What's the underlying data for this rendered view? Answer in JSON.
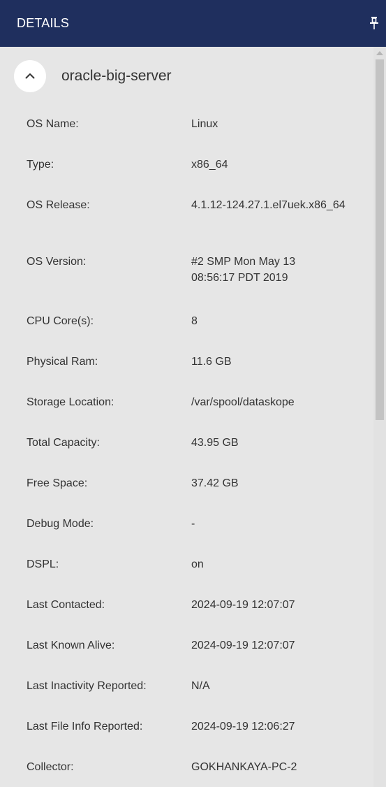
{
  "header": {
    "title": "DETAILS",
    "pin_icon": "pin-icon",
    "background": "#1f2f5e"
  },
  "server": {
    "name": "oracle-big-server",
    "toggle_icon": "chevron-up-icon"
  },
  "details": [
    {
      "label": "OS Name:",
      "value": "Linux"
    },
    {
      "label": "Type:",
      "value": "x86_64"
    },
    {
      "label": "OS Release:",
      "value": "4.1.12-124.27.1.el7uek.x86_64"
    },
    {
      "label": "OS Version:",
      "value": "#2 SMP Mon May 13 08:56:17 PDT 2019"
    },
    {
      "label": "CPU Core(s):",
      "value": "8"
    },
    {
      "label": "Physical Ram:",
      "value": "11.6 GB"
    },
    {
      "label": "Storage Location:",
      "value": "/var/spool/dataskope"
    },
    {
      "label": "Total Capacity:",
      "value": "43.95 GB"
    },
    {
      "label": "Free Space:",
      "value": "37.42 GB"
    },
    {
      "label": "Debug Mode:",
      "value": "-"
    },
    {
      "label": "DSPL:",
      "value": "on"
    },
    {
      "label": "Last Contacted:",
      "value": "2024-09-19 12:07:07"
    },
    {
      "label": "Last Known Alive:",
      "value": "2024-09-19 12:07:07"
    },
    {
      "label": "Last Inactivity Reported:",
      "value": "N/A"
    },
    {
      "label": "Last File Info Reported:",
      "value": "2024-09-19 12:06:27"
    },
    {
      "label": "Collector:",
      "value": "GOKHANKAYA-PC-2"
    }
  ]
}
